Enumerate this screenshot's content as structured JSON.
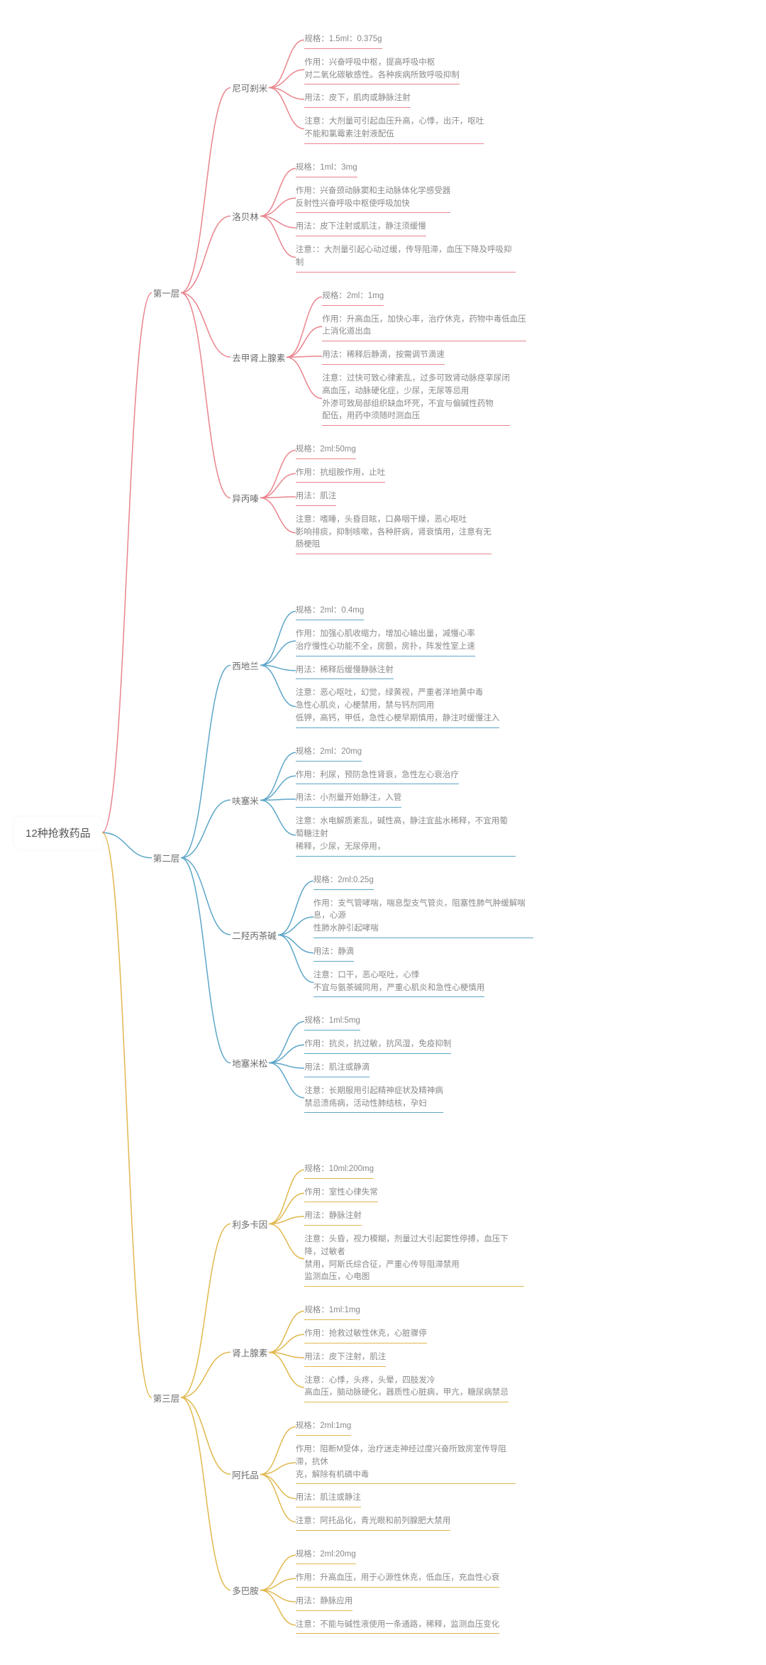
{
  "root": "12种抢救药品",
  "tiers": [
    {
      "label": "第一层",
      "theme": "pink",
      "drugs": [
        {
          "label": "尼可刹米",
          "leaves": [
            "规格：1.5ml：0.375g",
            "作用：兴奋呼吸中枢，提高呼吸中枢\n对二氧化碳敏感性。各种疾病所致呼吸抑制",
            "用法：皮下，肌肉或静脉注射",
            "注意：大剂量可引起血压升高，心悸，出汗，呕吐\n不能和氯霉素注射液配伍"
          ]
        },
        {
          "label": "洛贝林",
          "leaves": [
            "规格：1ml：3mg",
            "作用：兴奋颈动脉窦和主动脉体化学感受器\n反射性兴奋呼吸中枢使呼吸加快",
            "用法：皮下注射或肌注，静注须缓慢",
            "注意：：大剂量引起心动过缓，传导阻滞，血压下降及呼吸抑制"
          ]
        },
        {
          "label": "去甲肾上腺素",
          "leaves": [
            "规格：2ml：1mg",
            "作用：升高血压，加快心率，治疗休克，药物中毒低血压\n上消化道出血",
            "用法：稀释后静滴，按需调节滴速",
            "注意：过快可致心律紊乱，过多可致肾动脉痉挛尿闭\n高血压，动脉硬化症，少尿，无尿等忌用\n外渗可致局部组织缺血坏死，不宜与偏碱性药物\n配伍，用药中须随时测血压"
          ]
        },
        {
          "label": "异丙嗪",
          "leaves": [
            "规格：2ml:50mg",
            "作用：抗组胺作用，止吐",
            "用法：肌注",
            "注意：嗜睡，头昏目眩，口鼻咽干燥，恶心呕吐\n影响排痰，抑制咳嗽，各种肝病，肾衰慎用，注意有无\n肠梗阻"
          ]
        }
      ]
    },
    {
      "label": "第二层",
      "theme": "blue",
      "drugs": [
        {
          "label": "西地兰",
          "leaves": [
            "规格：2ml：0.4mg",
            "作用：加强心肌收缩力，增加心输出量，减慢心率\n治疗慢性心功能不全，房颤，房扑，阵发性室上速",
            "用法：稀释后缓慢静脉注射",
            "注意：恶心呕吐，幻觉，绿黄视，严重者洋地黄中毒\n急性心肌炎，心梗禁用，禁与钙剂同用\n低钾，高钙，甲低，急性心梗早期慎用，静注时缓慢注入"
          ]
        },
        {
          "label": "呋塞米",
          "leaves": [
            "规格：2ml：20mg",
            "作用：利尿，预防急性肾衰，急性左心衰治疗",
            "用法：小剂量开始静注，入管",
            "注意：水电解质紊乱，碱性高，静注宜盐水稀释，不宜用葡萄糖注射\n稀释，少尿，无尿停用，"
          ]
        },
        {
          "label": "二羟丙茶碱",
          "leaves": [
            "规格：2ml:0.25g",
            "作用：支气管哮喘，喘息型支气管炎，阻塞性肺气肿缓解喘息，心源\n性肺水肿引起哮喘",
            "用法：静滴",
            "注意：口干，恶心呕吐，心悸\n不宜与氨茶碱同用，严重心肌炎和急性心梗慎用"
          ]
        },
        {
          "label": "地塞米松",
          "leaves": [
            "规格：1ml:5mg",
            "作用：抗炎，抗过敏，抗风湿，免疫抑制",
            "用法：肌注或静滴",
            "注意：长期服用引起精神症状及精神病\n禁忌溃疡病，活动性肺结核，孕妇"
          ]
        }
      ]
    },
    {
      "label": "第三层",
      "theme": "yellow",
      "drugs": [
        {
          "label": "利多卡因",
          "leaves": [
            "规格：10ml:200mg",
            "作用：室性心律失常",
            "用法：静脉注射",
            "注意：头昏，视力模糊，剂量过大引起窦性停搏，血压下降，过敏者\n禁用，阿斯氏综合征，严重心传导阻滞禁用\n监测血压，心电图"
          ]
        },
        {
          "label": "肾上腺素",
          "leaves": [
            "规格：1ml:1mg",
            "作用：抢救过敏性休克，心脏骤停",
            "用法：皮下注射，肌注",
            "注意：心悸，头疼，头晕，四肢发冷\n高血压，脑动脉硬化，器质性心脏病，甲亢，糖尿病禁忌"
          ]
        },
        {
          "label": "阿托品",
          "leaves": [
            "规格：2ml:1mg",
            "作用：阻断M受体，治疗迷走神经过度兴奋所致房室传导阻滞，抗休\n克，解除有机磷中毒",
            "用法：肌注或静注",
            "注意：阿托品化，青光眼和前列腺肥大禁用"
          ]
        },
        {
          "label": "多巴胺",
          "leaves": [
            "规格：2ml:20mg",
            "作用：升高血压，用于心源性休克，低血压，充血性心衰",
            "用法：静脉应用",
            "注意：不能与碱性液使用一条通路，稀释，监测血压变化"
          ]
        }
      ]
    }
  ]
}
